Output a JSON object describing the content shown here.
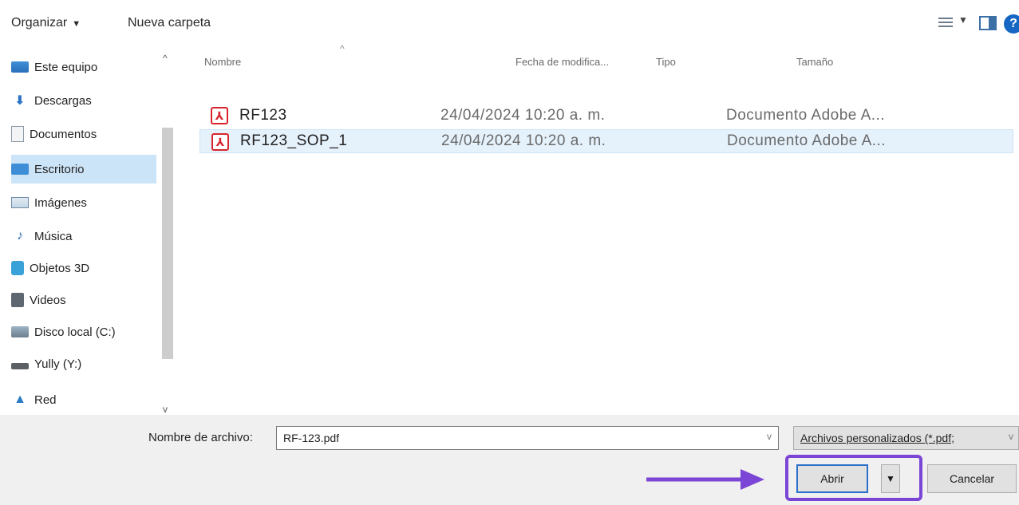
{
  "toolbar": {
    "organize_label": "Organizar",
    "new_folder_label": "Nueva carpeta"
  },
  "nav": {
    "items": [
      {
        "label": "Este equipo",
        "icon": "computer-icon"
      },
      {
        "label": "Descargas",
        "icon": "download-icon"
      },
      {
        "label": "Documentos",
        "icon": "document-icon"
      },
      {
        "label": "Escritorio",
        "icon": "desktop-icon",
        "selected": true
      },
      {
        "label": "Imágenes",
        "icon": "image-icon"
      },
      {
        "label": "Música",
        "icon": "music-icon"
      },
      {
        "label": "Objetos 3D",
        "icon": "cube-icon"
      },
      {
        "label": "Videos",
        "icon": "video-icon"
      },
      {
        "label": "Disco local (C:)",
        "icon": "disk-icon"
      },
      {
        "label": "Yully (Y:)",
        "icon": "drive-icon"
      },
      {
        "label": "Red",
        "icon": "network-icon"
      }
    ]
  },
  "list": {
    "columns": {
      "name": "Nombre",
      "date": "Fecha de modifica...",
      "type": "Tipo",
      "size": "Tamaño"
    },
    "files": [
      {
        "name": "RF123",
        "date": "24/04/2024 10:20 a. m.",
        "type": "Documento Adobe A..."
      },
      {
        "name": "RF123_SOP_1",
        "date": "24/04/2024 10:20 a. m.",
        "type": "Documento Adobe A..."
      }
    ]
  },
  "bottom": {
    "filename_label": "Nombre de archivo:",
    "filename_value": "RF-123.pdf",
    "filter_value": "Archivos personalizados (*.pdf;",
    "open_label": "Abrir",
    "cancel_label": "Cancelar"
  },
  "colors": {
    "highlight": "#7b45d6",
    "selection": "#cce4f7",
    "pdf_red": "#d8242c"
  }
}
